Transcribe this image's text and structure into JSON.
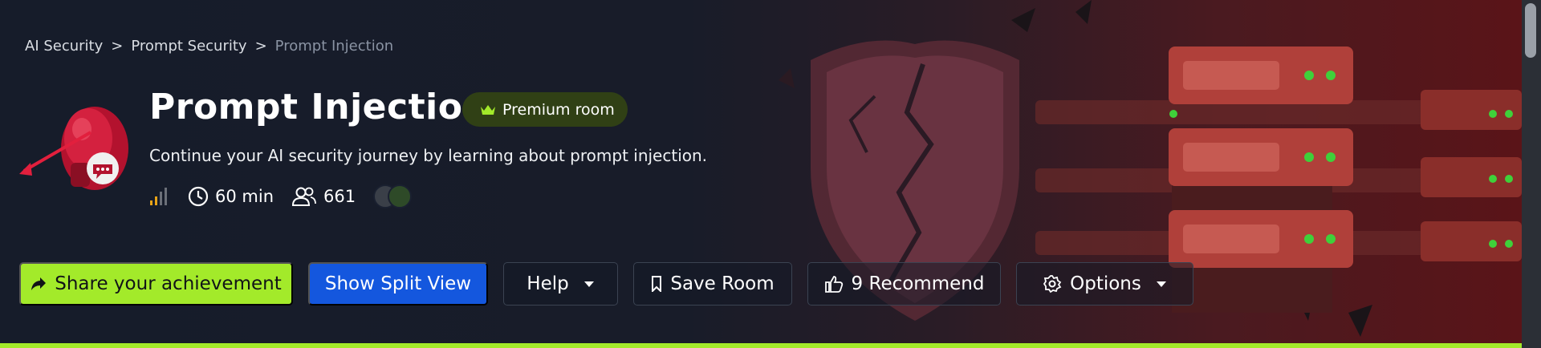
{
  "breadcrumb": {
    "items": [
      "AI Security",
      "Prompt Security",
      "Prompt Injection"
    ],
    "separator": ">"
  },
  "room": {
    "title": "Prompt Injection",
    "badge": "Premium room",
    "description": "Continue your AI security journey by learning about prompt injection.",
    "difficulty_icon": "signal-bars-icon",
    "duration": "60 min",
    "users": "661"
  },
  "actions": {
    "share": "Share your achievement",
    "split_view": "Show Split View",
    "help": "Help",
    "save": "Save Room",
    "recommend": "9 Recommend",
    "options": "Options"
  },
  "colors": {
    "accent_green": "#a3ea2a",
    "primary_blue": "#1457de",
    "background": "#161c2a",
    "premium_badge": "#304015"
  }
}
